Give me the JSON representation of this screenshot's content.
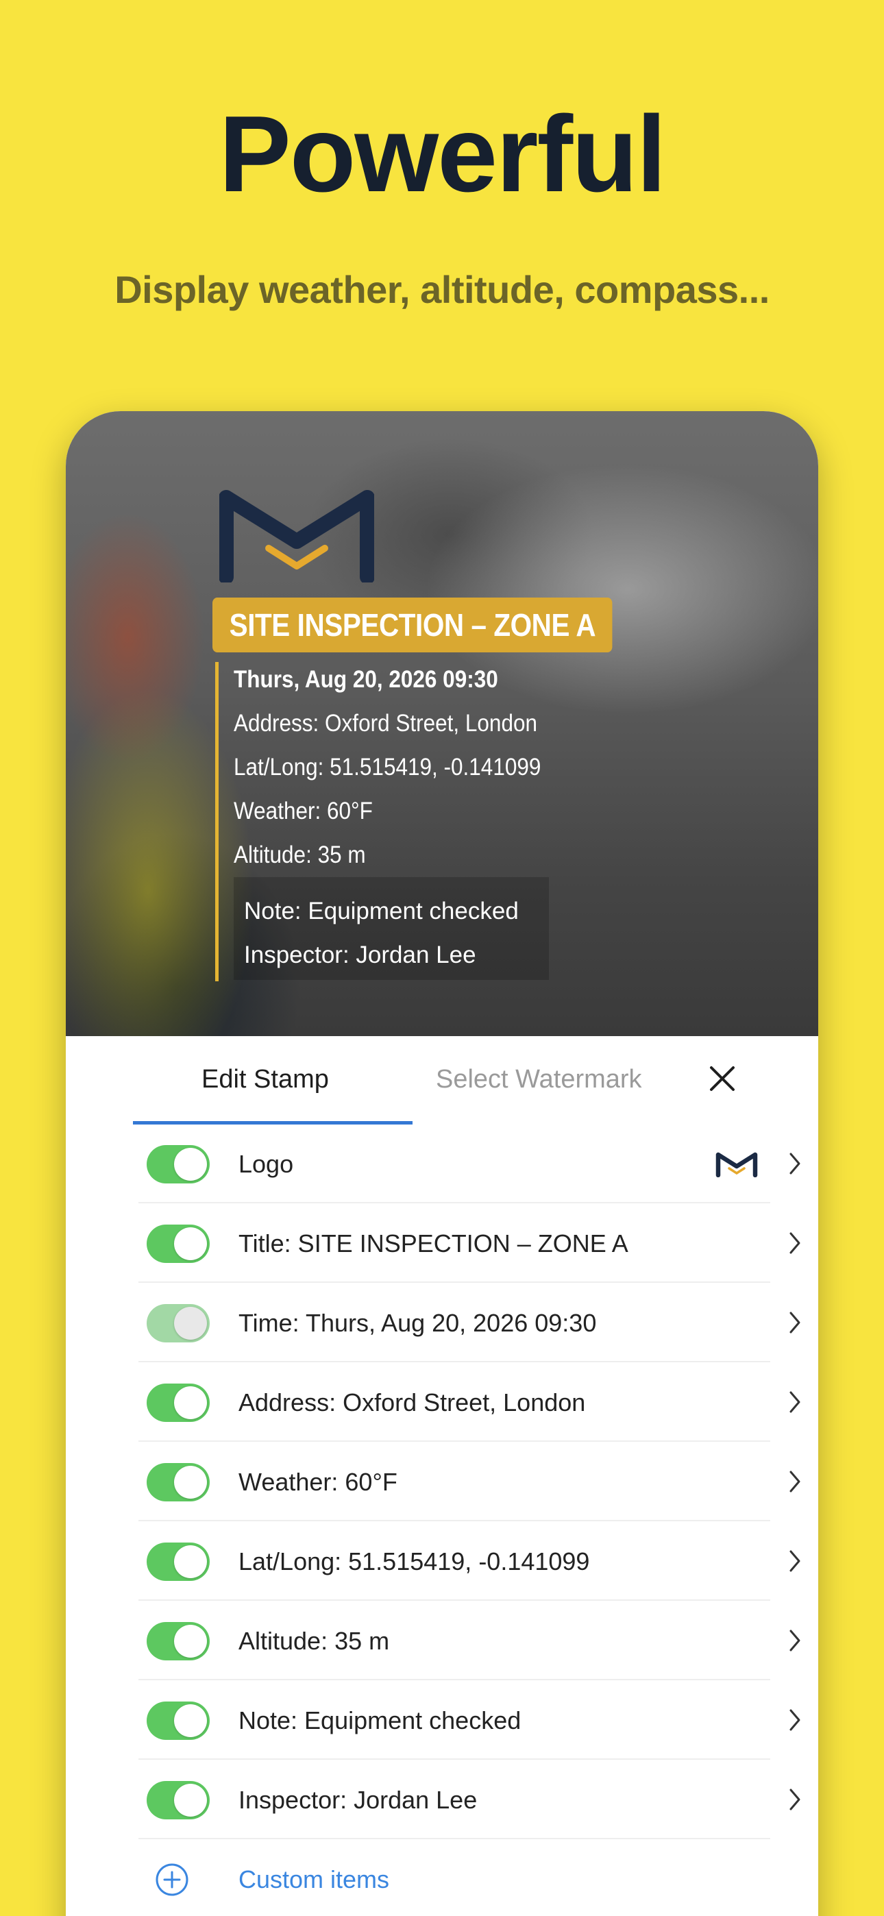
{
  "hero": {
    "title": "Powerful",
    "subtitle": "Display weather, altitude, compass..."
  },
  "preview": {
    "logo_icon": "m-logo-icon",
    "stamp_title": "SITE INSPECTION – ZONE A",
    "lines": [
      "Thurs, Aug 20, 2026 09:30",
      "Address: Oxford Street, London",
      "Lat/Long: 51.515419, -0.141099",
      "Weather: 60°F",
      "Altitude: 35 m"
    ],
    "note_lines": [
      "Note: Equipment checked",
      "Inspector: Jordan Lee"
    ],
    "colors": {
      "title_bg": "#D9A832",
      "accent_bar": "#E5B533"
    }
  },
  "panel": {
    "tabs": [
      {
        "label": "Edit Stamp",
        "active": true
      },
      {
        "label": "Select Watermark",
        "active": false
      }
    ],
    "close_icon": "close-icon",
    "rows": [
      {
        "label": "Logo",
        "enabled": true
      },
      {
        "label": "Title: SITE INSPECTION – ZONE A",
        "enabled": true
      },
      {
        "label": "Time: Thurs, Aug 20, 2026 09:30",
        "enabled": false
      },
      {
        "label": "Address: Oxford Street, London",
        "enabled": true
      },
      {
        "label": "Weather: 60°F",
        "enabled": true
      },
      {
        "label": "Lat/Long: 51.515419, -0.141099",
        "enabled": true
      },
      {
        "label": "Altitude: 35 m",
        "enabled": true
      },
      {
        "label": "Note: Equipment checked",
        "enabled": true
      },
      {
        "label": "Inspector: Jordan Lee",
        "enabled": true
      }
    ],
    "custom_items_label": "Custom items",
    "colors": {
      "toggle_on": "#5DC860",
      "accent": "#3478D4",
      "link": "#3A86E0"
    }
  },
  "colors": {
    "background": "#F8E43F",
    "headline": "#16202F",
    "logo_navy": "#1B2A44",
    "logo_gold": "#E6A92E"
  }
}
